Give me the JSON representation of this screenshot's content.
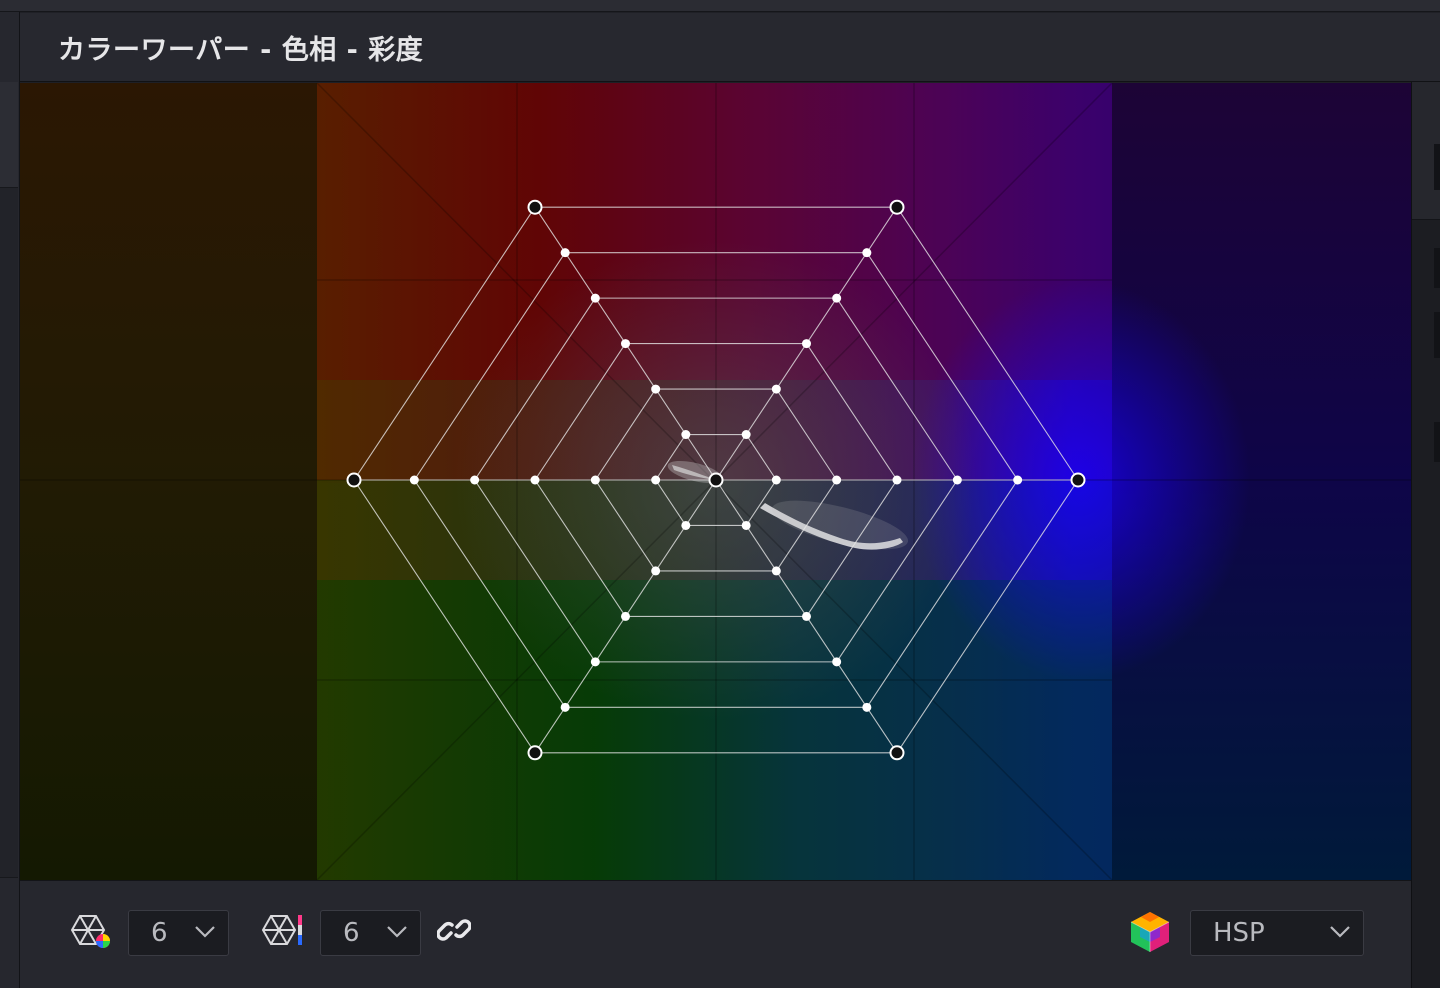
{
  "panel": {
    "title": "カラーワーパー - 色相 - 彩度"
  },
  "toolbar": {
    "hue_points": {
      "value": "6",
      "icon": "hue-grid-icon"
    },
    "sat_points": {
      "value": "6",
      "icon": "saturation-grid-icon"
    },
    "link": {
      "icon": "link-icon"
    },
    "color_space": {
      "value": "HSP",
      "icon": "color-cube-icon"
    }
  },
  "colors": {
    "panel_bg": "#26272e",
    "header_bg": "#27282f",
    "grid_line": "#e6e6e6",
    "control_point_major": "#111111",
    "control_point_minor": "#ffffff"
  },
  "grid": {
    "hue_divisions": 6,
    "saturation_rings": 6
  }
}
